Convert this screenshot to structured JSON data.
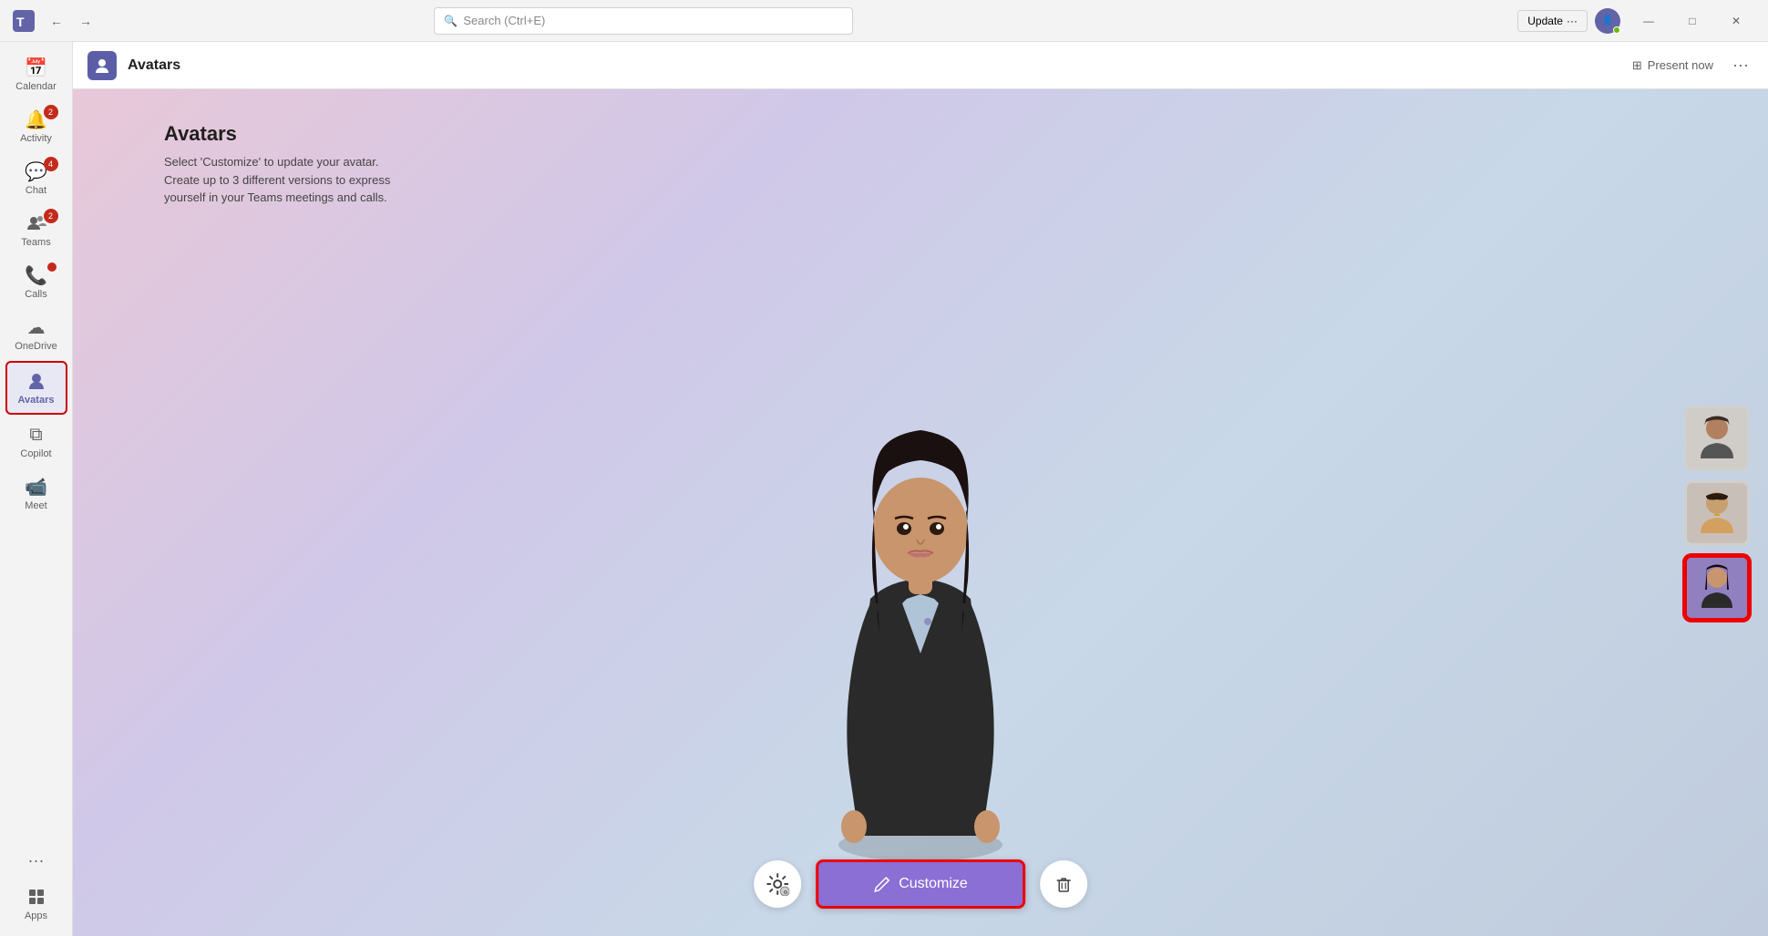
{
  "titlebar": {
    "app_name": "Microsoft Teams",
    "search_placeholder": "Search (Ctrl+E)",
    "update_label": "Update",
    "more_label": "···",
    "win_minimize": "—",
    "win_maximize": "□",
    "win_close": "✕"
  },
  "sidebar": {
    "items": [
      {
        "id": "calendar",
        "label": "Calendar",
        "icon": "📅",
        "badge": null
      },
      {
        "id": "activity",
        "label": "Activity",
        "icon": "🔔",
        "badge": "2",
        "badge_type": "red"
      },
      {
        "id": "chat",
        "label": "Chat",
        "icon": "💬",
        "badge": "4",
        "badge_type": "red"
      },
      {
        "id": "teams",
        "label": "Teams",
        "icon": "👥",
        "badge": "2",
        "badge_type": "red"
      },
      {
        "id": "calls",
        "label": "Calls",
        "icon": "📞",
        "badge": "dot",
        "badge_type": "red-dot"
      },
      {
        "id": "onedrive",
        "label": "OneDrive",
        "icon": "☁",
        "badge": null
      },
      {
        "id": "avatars",
        "label": "Avatars",
        "icon": "👤",
        "badge": null,
        "active": true
      },
      {
        "id": "copilot",
        "label": "Copilot",
        "icon": "⧉",
        "badge": null
      },
      {
        "id": "meet",
        "label": "Meet",
        "icon": "📹",
        "badge": null
      }
    ],
    "dots_label": "···",
    "apps_label": "Apps",
    "apps_icon": "+"
  },
  "app_header": {
    "icon": "👤",
    "title": "Avatars",
    "present_now_label": "Present now",
    "more_options_label": "···"
  },
  "avatars_page": {
    "heading": "Avatars",
    "description_line1": "Select 'Customize' to update your avatar.",
    "description_line2": "Create up to 3 different versions to express",
    "description_line3": "yourself in your Teams meetings and calls.",
    "customize_label": "Customize",
    "delete_tooltip": "Delete",
    "settings_tooltip": "Avatar settings"
  }
}
